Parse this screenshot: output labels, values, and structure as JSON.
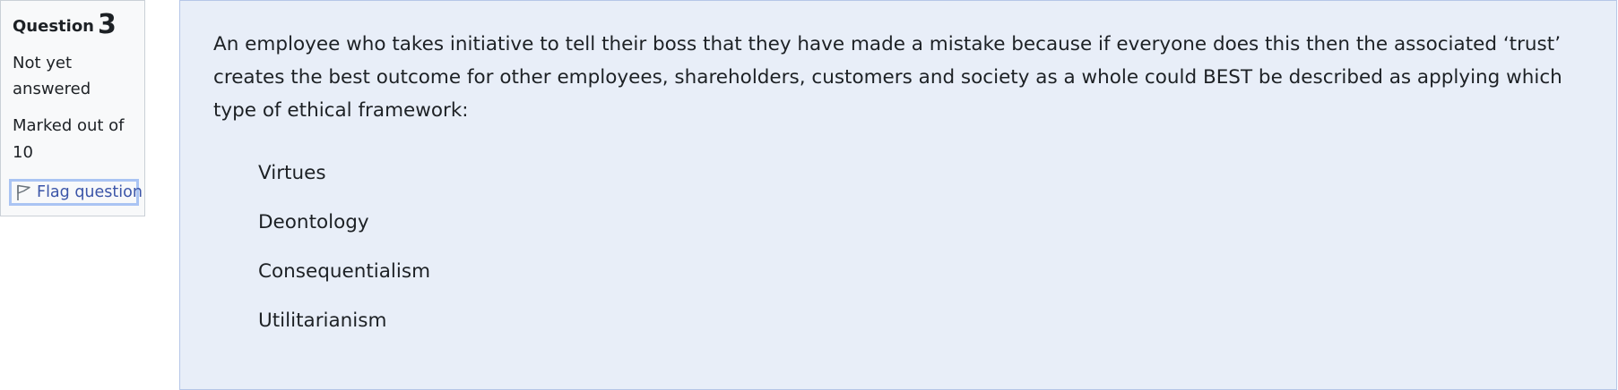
{
  "info": {
    "question_label": "Question",
    "question_number": "3",
    "state": "Not yet answered",
    "grade": "Marked out of 10",
    "flag_label": "Flag question",
    "flag_icon": "flag-icon"
  },
  "question": {
    "text": "An employee who takes initiative to tell their boss that they have made a mistake because if everyone does this then the associated ‘trust’ creates the best outcome for other employees, shareholders, customers and society as a whole could BEST be described as applying which type of ethical framework:",
    "answers": [
      "Virtues",
      "Deontology",
      "Consequentialism",
      "Utilitarianism"
    ]
  },
  "colors": {
    "info_background": "#f8f9fa",
    "content_background": "#e8eef8",
    "content_border": "#b6c7e8",
    "flag_focus_border": "#aac4f3",
    "link": "#3b55a8"
  }
}
